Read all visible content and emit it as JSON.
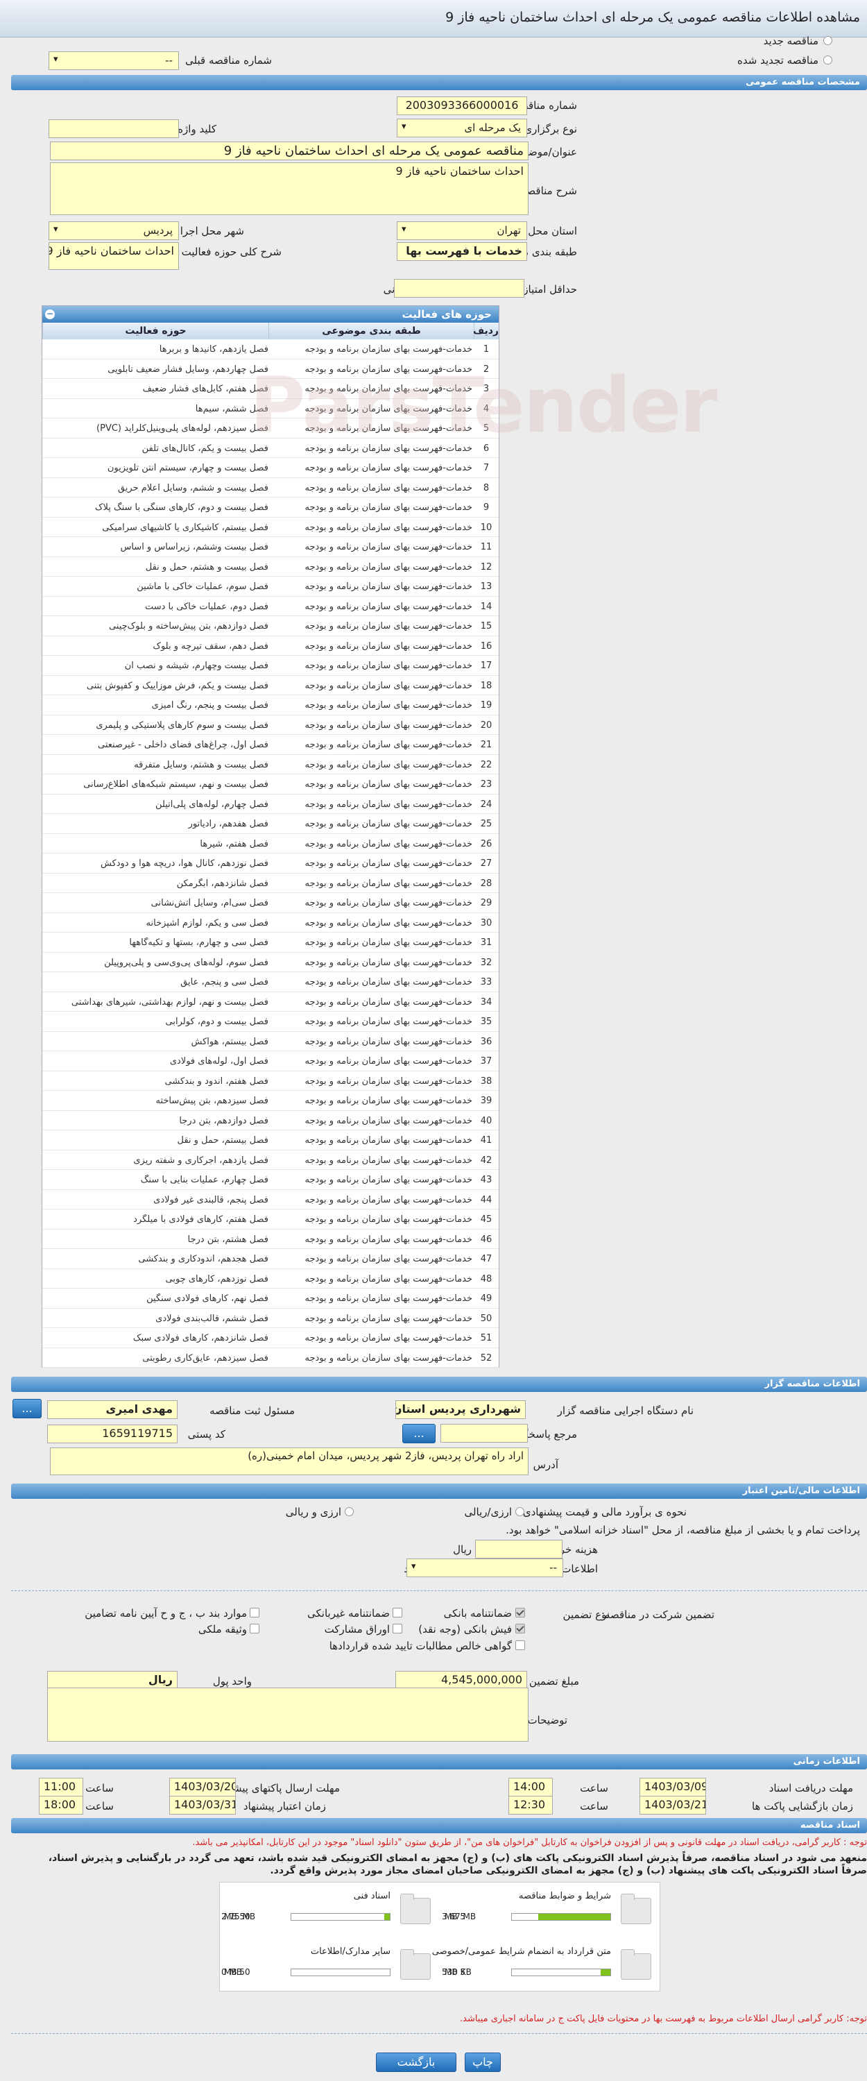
{
  "window_title": "مشاهده اطلاعات مناقصه عمومی یک مرحله ای احداث ساختمان ناحیه فاز 9",
  "top": {
    "new_tender": "مناقصه جدید",
    "renewed_tender": "مناقصه تجدید شده",
    "prev_tender_no_label": "شماره مناقصه قبلی",
    "prev_tender_no_value": "--"
  },
  "sections": {
    "specs": "مشخصات مناقصه عمومی",
    "activity_grid": "حوزه های فعالیت",
    "organizer": "اطلاعات مناقصه گزار",
    "finance": "اطلاعات مالی/تامین اعتبار",
    "timing": "اطلاعات زمانی",
    "documents": "اسناد مناقصه"
  },
  "specs": {
    "tender_no_label": "شماره مناقصه",
    "tender_no": "2003093366000016",
    "holding_type_label": "نوع برگزاری",
    "holding_type": "یک مرحله ای",
    "keyword_label": "کلید واژه",
    "keyword": "",
    "subject_label": "عنوان/موضوع مناقصه",
    "subject": "مناقصه عمومی یک مرحله ای احداث ساختمان ناحیه فاز 9",
    "description_label": "شرح مناقصه",
    "description": "احداث ساختمان ناحیه فاز 9",
    "province_label": "استان محل اجرا",
    "province": "تهران",
    "city_label": "شهر محل اجرا",
    "city": "پردیس",
    "category_label": "طبقه بندی موضوعی",
    "category": "خدمات با فهرست بها",
    "activity_desc_label": "شرح کلی حوزه فعالیت",
    "activity_desc": "احداث ساختمان ناحیه فاز 9",
    "min_score_label": "حداقل امتیاز قابل قبول ارزیابی فنی/بازرگانی",
    "min_score": ""
  },
  "grid": {
    "col_row": "ردیف",
    "col_category": "طبقه بندی موضوعی",
    "col_activity": "حوزه فعالیت",
    "rows": [
      [
        "1",
        "خدمات-فهرست بهای سازمان برنامه و بودجه",
        "فصل یازدهم، کانیدها و بربرها"
      ],
      [
        "2",
        "خدمات-فهرست بهای سازمان برنامه و بودجه",
        "فصل چهاردهم، وسایل فشار ضعیف تابلویی"
      ],
      [
        "3",
        "خدمات-فهرست بهای سازمان برنامه و بودجه",
        "فصل هفتم، کابل‌های فشار ضعیف"
      ],
      [
        "4",
        "خدمات-فهرست بهای سازمان برنامه و بودجه",
        "فصل ششم، سیم‌ها"
      ],
      [
        "5",
        "خدمات-فهرست بهای سازمان برنامه و بودجه",
        "فصل سیزدهم، لوله‌های پلی‌وینیل‌کلراید (PVC)"
      ],
      [
        "6",
        "خدمات-فهرست بهای سازمان برنامه و بودجه",
        "فصل بیست و یکم، کانال‌های تلفن"
      ],
      [
        "7",
        "خدمات-فهرست بهای سازمان برنامه و بودجه",
        "فصل بیست و چهارم، سیستم آنتن تلویزیون"
      ],
      [
        "8",
        "خدمات-فهرست بهای سازمان برنامه و بودجه",
        "فصل بیست و ششم، وسایل اعلام حریق"
      ],
      [
        "9",
        "خدمات-فهرست بهای سازمان برنامه و بودجه",
        "فصل بیست و دوم، کارهای سنگی با سنگ پلاک"
      ],
      [
        "10",
        "خدمات-فهرست بهای سازمان برنامه و بودجه",
        "فصل بیستم، کاشیکاری یا کاشیهای سرامیکی"
      ],
      [
        "11",
        "خدمات-فهرست بهای سازمان برنامه و بودجه",
        "فصل بیست وششم، زیراساس و اساس"
      ],
      [
        "12",
        "خدمات-فهرست بهای سازمان برنامه و بودجه",
        "فصل بیست و هشتم، حمل و نقل"
      ],
      [
        "13",
        "خدمات-فهرست بهای سازمان برنامه و بودجه",
        "فصل سوم، عملیات خاکی با ماشین"
      ],
      [
        "14",
        "خدمات-فهرست بهای سازمان برنامه و بودجه",
        "فصل دوم، عملیات خاکی با دست"
      ],
      [
        "15",
        "خدمات-فهرست بهای سازمان برنامه و بودجه",
        "فصل دوازدهم، بتن پیش‌ساخته و بلوک‌چینی"
      ],
      [
        "16",
        "خدمات-فهرست بهای سازمان برنامه و بودجه",
        "فصل دهم، سقف تیرچه و بلوک"
      ],
      [
        "17",
        "خدمات-فهرست بهای سازمان برنامه و بودجه",
        "فصل بیست وچهارم، شیشه و نصب آن"
      ],
      [
        "18",
        "خدمات-فهرست بهای سازمان برنامه و بودجه",
        "فصل بیست و یکم، فرش موزاییک و کفپوش بتنی"
      ],
      [
        "19",
        "خدمات-فهرست بهای سازمان برنامه و بودجه",
        "فصل بیست و پنجم، رنگ آمیزی"
      ],
      [
        "20",
        "خدمات-فهرست بهای سازمان برنامه و بودجه",
        "فصل بیست و سوم کارهای پلاستیکی و پلیمری"
      ],
      [
        "21",
        "خدمات-فهرست بهای سازمان برنامه و بودجه",
        "فصل اول، چراغ‌های فضای داخلی - غیرصنعتی"
      ],
      [
        "22",
        "خدمات-فهرست بهای سازمان برنامه و بودجه",
        "فصل بیست و هشتم، وسایل متفرقه"
      ],
      [
        "23",
        "خدمات-فهرست بهای سازمان برنامه و بودجه",
        "فصل بیست و نهم، سیستم شبکه‌های اطلاع‌رسانی"
      ],
      [
        "24",
        "خدمات-فهرست بهای سازمان برنامه و بودجه",
        "فصل چهارم، لوله‌های پلی‌اتیلن"
      ],
      [
        "25",
        "خدمات-فهرست بهای سازمان برنامه و بودجه",
        "فصل هفدهم، رادیاتور"
      ],
      [
        "26",
        "خدمات-فهرست بهای سازمان برنامه و بودجه",
        "فصل هفتم، شیرها"
      ],
      [
        "27",
        "خدمات-فهرست بهای سازمان برنامه و بودجه",
        "فصل نوزدهم، کانال هوا، دریچه هوا و دودکش"
      ],
      [
        "28",
        "خدمات-فهرست بهای سازمان برنامه و بودجه",
        "فصل شانزدهم، آبگرمکن"
      ],
      [
        "29",
        "خدمات-فهرست بهای سازمان برنامه و بودجه",
        "فصل سی‌ام، وسایل آتش‌نشانی"
      ],
      [
        "30",
        "خدمات-فهرست بهای سازمان برنامه و بودجه",
        "فصل سی و یکم، لوازم آشپزخانه"
      ],
      [
        "31",
        "خدمات-فهرست بهای سازمان برنامه و بودجه",
        "فصل سی و چهارم، بستها و تکیه‌گاهها"
      ],
      [
        "32",
        "خدمات-فهرست بهای سازمان برنامه و بودجه",
        "فصل سوم، لوله‌های پی‌وی‌سی و پلی‌پروپیلن"
      ],
      [
        "33",
        "خدمات-فهرست بهای سازمان برنامه و بودجه",
        "فصل سی و پنجم، عایق"
      ],
      [
        "34",
        "خدمات-فهرست بهای سازمان برنامه و بودجه",
        "فصل بیست و نهم، لوازم بهداشتی، شیرهای بهداشتی"
      ],
      [
        "35",
        "خدمات-فهرست بهای سازمان برنامه و بودجه",
        "فصل بیست و دوم، کولرآبی"
      ],
      [
        "36",
        "خدمات-فهرست بهای سازمان برنامه و بودجه",
        "فصل بیستم، هواکش"
      ],
      [
        "37",
        "خدمات-فهرست بهای سازمان برنامه و بودجه",
        "فصل اول، لوله‌های فولادی"
      ],
      [
        "38",
        "خدمات-فهرست بهای سازمان برنامه و بودجه",
        "فصل هفتم، اندود و بندکشی"
      ],
      [
        "39",
        "خدمات-فهرست بهای سازمان برنامه و بودجه",
        "فصل سیزدهم، بتن پیش‌ساخته"
      ],
      [
        "40",
        "خدمات-فهرست بهای سازمان برنامه و بودجه",
        "فصل دوازدهم، بتن درجا"
      ],
      [
        "41",
        "خدمات-فهرست بهای سازمان برنامه و بودجه",
        "فصل بیستم، حمل و نقل"
      ],
      [
        "42",
        "خدمات-فهرست بهای سازمان برنامه و بودجه",
        "فصل یازدهم، آجرکاری و شفته ریزی"
      ],
      [
        "43",
        "خدمات-فهرست بهای سازمان برنامه و بودجه",
        "فصل چهارم، عملیات بنایی با سنگ"
      ],
      [
        "44",
        "خدمات-فهرست بهای سازمان برنامه و بودجه",
        "فصل پنجم، قالبندی غیر فولادی"
      ],
      [
        "45",
        "خدمات-فهرست بهای سازمان برنامه و بودجه",
        "فصل هفتم، کارهای فولادی با میلگرد"
      ],
      [
        "46",
        "خدمات-فهرست بهای سازمان برنامه و بودجه",
        "فصل هشتم، بتن درجا"
      ],
      [
        "47",
        "خدمات-فهرست بهای سازمان برنامه و بودجه",
        "فصل هجدهم، اندودکاری و بندکشی"
      ],
      [
        "48",
        "خدمات-فهرست بهای سازمان برنامه و بودجه",
        "فصل نوزدهم، کارهای چوبی"
      ],
      [
        "49",
        "خدمات-فهرست بهای سازمان برنامه و بودجه",
        "فصل نهم، کارهای فولادی سنگین"
      ],
      [
        "50",
        "خدمات-فهرست بهای سازمان برنامه و بودجه",
        "فصل ششم، قالب‌بندی فولادی"
      ],
      [
        "51",
        "خدمات-فهرست بهای سازمان برنامه و بودجه",
        "فصل شانزدهم، کارهای فولادی سبک"
      ],
      [
        "52",
        "خدمات-فهرست بهای سازمان برنامه و بودجه",
        "فصل سیزدهم، عایق‌کاری رطوبتی"
      ]
    ]
  },
  "organizer": {
    "agency_label": "نام دستگاه اجرایی مناقصه گزار",
    "agency": "شهرداری پردیس استان تهران",
    "officer_label": "مسئول ثبت مناقصه",
    "officer": "مهدی امیری",
    "ref_label": "مرجع پاسخگویی",
    "ref": "",
    "postal_label": "کد پستی",
    "postal": "1659119715",
    "address_label": "آدرس",
    "address": "اراد راه تهران پردیس، فاز2 شهر پردیس، میدان امام خمینی(ره)",
    "dots": "..."
  },
  "finance": {
    "price_method_label": "نحوه ی برآورد مالی و قیمت پیشنهادی",
    "rial_label": "ارزی/ریالی",
    "currency_rial_label": "ارزی و ریالی",
    "note": "پرداخت تمام و یا بخشی از مبلغ مناقصه، از محل \"اسناد خزانه اسلامی\" خواهد بود.",
    "doc_fee_label": "هزینه خرید اسناد",
    "doc_fee": "",
    "rial_unit": "ریال",
    "account_label": "اطلاعات حساب جهت واریز هزینه خرید اسناد",
    "account": "--",
    "participation_label": "تضمین شرکت در مناقصه:",
    "guarantee_type_label": "نوع تضمین",
    "guarantees": [
      "ضمانتنامه بانکی",
      "ضمانتنامه غیربانکی",
      "موارد بند ب ، ج و ح آیین نامه تضامین",
      "فیش بانکی (وجه نقد)",
      "اوراق مشارکت",
      "وثیقه ملکی",
      "گواهی خالص مطالبات تایید شده قراردادها"
    ],
    "amount_label": "مبلغ تضمین",
    "amount": "4,545,000,000",
    "unit_label": "واحد پول",
    "unit": "ریال",
    "notes_label": "توضیحات",
    "notes": ""
  },
  "timing": {
    "receive_deadline_label": "مهلت دریافت اسناد",
    "receive_date": "1403/03/09",
    "receive_time": "14:00",
    "send_deadline_label": "مهلت ارسال پاکتهای پیشنهاد",
    "send_date": "1403/03/20",
    "send_time": "11:00",
    "open_label": "زمان بازگشایی پاکت ها",
    "open_date": "1403/03/21",
    "open_time": "12:30",
    "validity_label": "زمان اعتبار پیشنهاد",
    "validity_date": "1403/03/31",
    "validity_time": "18:00",
    "time_label": "ساعت"
  },
  "documents": {
    "note1": "توجه : کاربر گرامی، دریافت اسناد در مهلت قانونی و پس از افزودن فراخوان به کارتابل \"فراخوان های من\"، از طریق ستون \"دانلود اسناد\" موجود در این کارتابل، امکانپذیر می باشد.",
    "note2": "منعهد می شود در اسناد مناقصه، صرفاً پذیرش اسناد الکترونیکی پاکت های (ب) و (ج) مجهز به امضای الکترونیکی قید شده باشد، تعهد می گردد در بارگشایی و پذیرش اسناد،",
    "note3": "صرفاً اسناد الکترونیکی پاکت های پیشنهاد (ب) و (ج) مجهز به امضای الکترونیکی صاحبان امضای مجاز مورد پذیرش واقع گردد.",
    "files": [
      {
        "label": "شرایط و ضوابط مناقصه",
        "max": "5 MB",
        "used": "3.67 MB",
        "fill": 0.73
      },
      {
        "label": "اسناد فنی",
        "max": "50 MB",
        "used": "2.75 MB",
        "fill": 0.055
      },
      {
        "label": "متن قرارداد به انضمام شرایط عمومی/خصوصی",
        "max": "5 MB",
        "used": "530 KB",
        "fill": 0.1
      },
      {
        "label": "سایر مدارک/اطلاعات",
        "max": "50 MB",
        "used": "0 MB",
        "fill": 0
      }
    ],
    "footnote": "توجه: کاربر گرامی ارسال اطلاعات مربوط به فهرست بها در محتویات فایل پاکت ج در سامانه اجباری میباشد."
  },
  "buttons": {
    "print": "چاپ",
    "back": "بازگشت"
  },
  "colors": {
    "accent": "#3f86c6",
    "field": "#ffffc6",
    "red_note": "#d61f1f"
  }
}
